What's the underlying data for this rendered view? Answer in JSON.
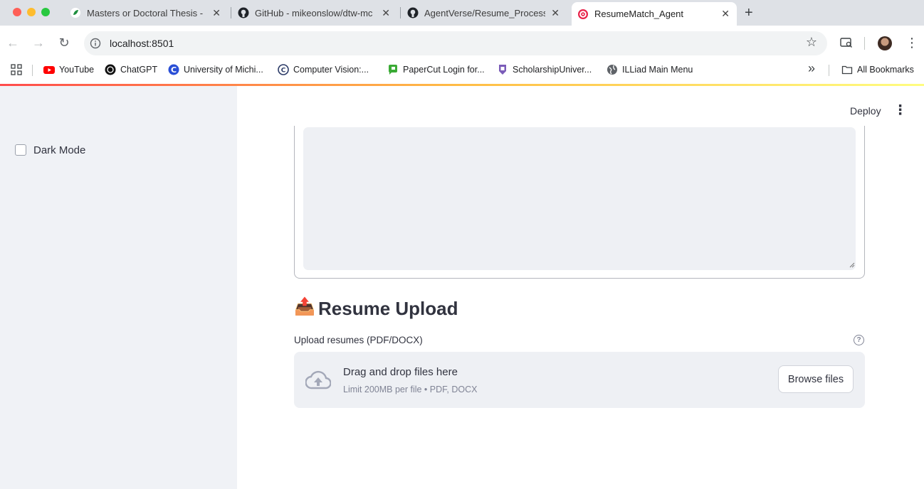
{
  "browser": {
    "tabs": [
      {
        "title": "Masters or Doctoral Thesis - "
      },
      {
        "title": "GitHub - mikeonslow/dtw-mc"
      },
      {
        "title": "AgentVerse/Resume_Process"
      },
      {
        "title": "ResumeMatch_Agent"
      }
    ],
    "url": "localhost:8501",
    "bookmarks": [
      {
        "label": "YouTube"
      },
      {
        "label": "ChatGPT"
      },
      {
        "label": "University of Michi..."
      },
      {
        "label": "Computer Vision:..."
      },
      {
        "label": "PaperCut Login for..."
      },
      {
        "label": "ScholarshipUniver..."
      },
      {
        "label": "ILLiad Main Menu"
      }
    ],
    "all_bookmarks": "All Bookmarks",
    "more_bookmarks": "»"
  },
  "sidebar": {
    "dark_mode_label": "Dark Mode"
  },
  "header": {
    "deploy_label": "Deploy",
    "menu_glyph": "⋮"
  },
  "resume_section": {
    "title_emoji": "📤",
    "title": "Resume Upload",
    "uploader_label": "Upload resumes (PDF/DOCX)",
    "help_glyph": "?",
    "dropzone_title": "Drag and drop files here",
    "dropzone_hint": "Limit 200MB per file • PDF, DOCX",
    "browse_label": "Browse files"
  }
}
